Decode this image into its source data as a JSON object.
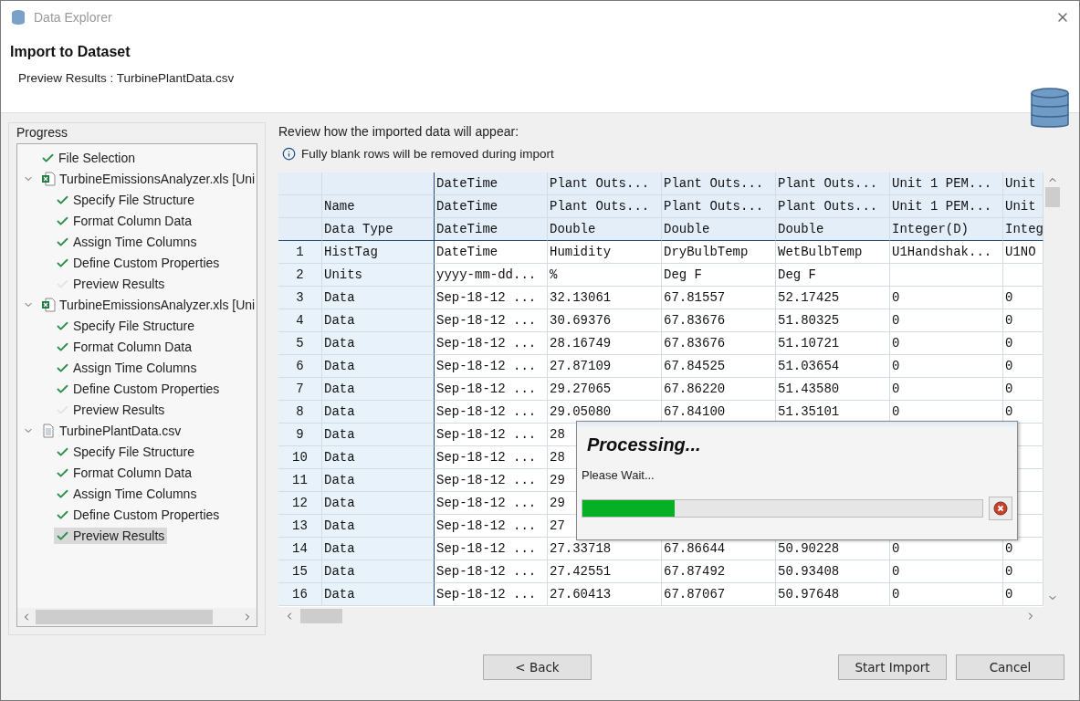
{
  "window": {
    "title": "Data Explorer"
  },
  "header": {
    "title": "Import to Dataset",
    "subtitle": "Preview Results : TurbinePlantData.csv"
  },
  "progress": {
    "title": "Progress",
    "items": [
      {
        "label": "File Selection",
        "kind": "step",
        "done": true,
        "selected": false
      },
      {
        "label": "TurbineEmissionsAnalyzer.xls [Uni",
        "kind": "xls",
        "expanded": true,
        "selected": false,
        "children": [
          {
            "label": "Specify File Structure",
            "kind": "step",
            "done": true,
            "selected": false
          },
          {
            "label": "Format Column Data",
            "kind": "step",
            "done": true,
            "selected": false
          },
          {
            "label": "Assign Time Columns",
            "kind": "step",
            "done": true,
            "selected": false
          },
          {
            "label": "Define Custom Properties",
            "kind": "step",
            "done": true,
            "selected": false
          },
          {
            "label": "Preview Results",
            "kind": "step",
            "done": false,
            "selected": false
          }
        ]
      },
      {
        "label": "TurbineEmissionsAnalyzer.xls [Uni",
        "kind": "xls",
        "expanded": true,
        "selected": false,
        "children": [
          {
            "label": "Specify File Structure",
            "kind": "step",
            "done": true,
            "selected": false
          },
          {
            "label": "Format Column Data",
            "kind": "step",
            "done": true,
            "selected": false
          },
          {
            "label": "Assign Time Columns",
            "kind": "step",
            "done": true,
            "selected": false
          },
          {
            "label": "Define Custom Properties",
            "kind": "step",
            "done": true,
            "selected": false
          },
          {
            "label": "Preview Results",
            "kind": "step",
            "done": false,
            "selected": false
          }
        ]
      },
      {
        "label": "TurbinePlantData.csv",
        "kind": "csv",
        "expanded": true,
        "selected": false,
        "children": [
          {
            "label": "Specify File Structure",
            "kind": "step",
            "done": true,
            "selected": false
          },
          {
            "label": "Format Column Data",
            "kind": "step",
            "done": true,
            "selected": false
          },
          {
            "label": "Assign Time Columns",
            "kind": "step",
            "done": true,
            "selected": false
          },
          {
            "label": "Define Custom Properties",
            "kind": "step",
            "done": true,
            "selected": false
          },
          {
            "label": "Preview Results",
            "kind": "step",
            "done": true,
            "selected": true
          }
        ]
      }
    ]
  },
  "review": {
    "heading": "Review how the imported data will appear:",
    "note": "Fully blank rows will be removed during import"
  },
  "table": {
    "header_rows": [
      {
        "cells": [
          null,
          "DateTime",
          "Plant Outs...",
          "Plant Outs...",
          "Plant Outs...",
          "Unit 1 PEM...",
          "Unit"
        ]
      },
      {
        "cells": [
          "Name",
          "DateTime",
          "Plant Outs...",
          "Plant Outs...",
          "Plant Outs...",
          "Unit 1 PEM...",
          "Unit"
        ]
      },
      {
        "cells": [
          "Data Type",
          "DateTime",
          "Double",
          "Double",
          "Double",
          "Integer(D)",
          "Integ"
        ]
      }
    ],
    "rows": [
      {
        "number": "1",
        "cells": [
          "HistTag",
          "DateTime",
          "Humidity",
          "DryBulbTemp",
          "WetBulbTemp",
          "U1Handshak...",
          "U1NO"
        ]
      },
      {
        "number": "2",
        "cells": [
          "Units",
          "yyyy-mm-dd...",
          "%",
          "Deg F",
          "Deg F",
          null,
          null
        ]
      },
      {
        "number": "3",
        "cells": [
          "Data",
          "Sep-18-12 ...",
          "32.13061",
          "67.81557",
          "52.17425",
          "0",
          "0"
        ]
      },
      {
        "number": "4",
        "cells": [
          "Data",
          "Sep-18-12 ...",
          "30.69376",
          "67.83676",
          "51.80325",
          "0",
          "0"
        ]
      },
      {
        "number": "5",
        "cells": [
          "Data",
          "Sep-18-12 ...",
          "28.16749",
          "67.83676",
          "51.10721",
          "0",
          "0"
        ]
      },
      {
        "number": "6",
        "cells": [
          "Data",
          "Sep-18-12 ...",
          "27.87109",
          "67.84525",
          "51.03654",
          "0",
          "0"
        ]
      },
      {
        "number": "7",
        "cells": [
          "Data",
          "Sep-18-12 ...",
          "29.27065",
          "67.86220",
          "51.43580",
          "0",
          "0"
        ]
      },
      {
        "number": "8",
        "cells": [
          "Data",
          "Sep-18-12 ...",
          "29.05080",
          "67.84100",
          "51.35101",
          "0",
          "0"
        ]
      },
      {
        "number": "9",
        "cells": [
          "Data",
          "Sep-18-12 ...",
          "28",
          null,
          null,
          null,
          null
        ]
      },
      {
        "number": "10",
        "cells": [
          "Data",
          "Sep-18-12 ...",
          "28",
          null,
          null,
          null,
          null
        ]
      },
      {
        "number": "11",
        "cells": [
          "Data",
          "Sep-18-12 ...",
          "29",
          null,
          null,
          null,
          null
        ]
      },
      {
        "number": "12",
        "cells": [
          "Data",
          "Sep-18-12 ...",
          "29",
          null,
          null,
          null,
          null
        ]
      },
      {
        "number": "13",
        "cells": [
          "Data",
          "Sep-18-12 ...",
          "27",
          null,
          null,
          null,
          null
        ]
      },
      {
        "number": "14",
        "cells": [
          "Data",
          "Sep-18-12 ...",
          "27.33718",
          "67.86644",
          "50.90228",
          "0",
          "0"
        ]
      },
      {
        "number": "15",
        "cells": [
          "Data",
          "Sep-18-12 ...",
          "27.42551",
          "67.87492",
          "50.93408",
          "0",
          "0"
        ]
      },
      {
        "number": "16",
        "cells": [
          "Data",
          "Sep-18-12 ...",
          "27.60413",
          "67.87067",
          "50.97648",
          "0",
          "0"
        ]
      }
    ]
  },
  "processing": {
    "title": "Processing...",
    "message": "Please Wait...",
    "level": 0.23
  },
  "buttons": {
    "back": "< Back",
    "start": "Start Import",
    "cancel": "Cancel"
  }
}
